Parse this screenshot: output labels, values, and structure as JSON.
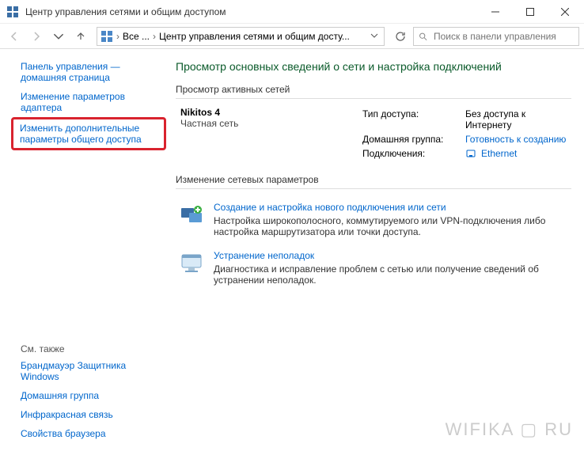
{
  "window": {
    "title": "Центр управления сетями и общим доступом"
  },
  "breadcrumb": {
    "item1": "Все ...",
    "item2": "Центр управления сетями и общим досту..."
  },
  "search": {
    "placeholder": "Поиск в панели управления"
  },
  "sidebar": {
    "items": [
      "Панель управления — домашняя страница",
      "Изменение параметров адаптера",
      "Изменить дополнительные параметры общего доступа"
    ],
    "see_also_title": "См. также",
    "see_also": [
      "Брандмауэр Защитника Windows",
      "Домашняя группа",
      "Инфракрасная связь",
      "Свойства браузера"
    ]
  },
  "main": {
    "page_title": "Просмотр основных сведений о сети и настройка подключений",
    "active_networks_header": "Просмотр активных сетей",
    "network": {
      "name": "Nikitos  4",
      "type": "Частная сеть",
      "props": {
        "access_label": "Тип доступа:",
        "access_value": "Без доступа к Интернету",
        "homegroup_label": "Домашняя группа:",
        "homegroup_value": "Готовность к созданию",
        "conn_label": "Подключения:",
        "conn_value": "Ethernet"
      }
    },
    "change_settings_header": "Изменение сетевых параметров",
    "tasks": [
      {
        "title": "Создание и настройка нового подключения или сети",
        "desc": "Настройка широкополосного, коммутируемого или VPN-подключения либо настройка маршрутизатора или точки доступа."
      },
      {
        "title": "Устранение неполадок",
        "desc": "Диагностика и исправление проблем с сетью или получение сведений об устранении неполадок."
      }
    ]
  },
  "watermark": "WIFIKA ▢ RU"
}
